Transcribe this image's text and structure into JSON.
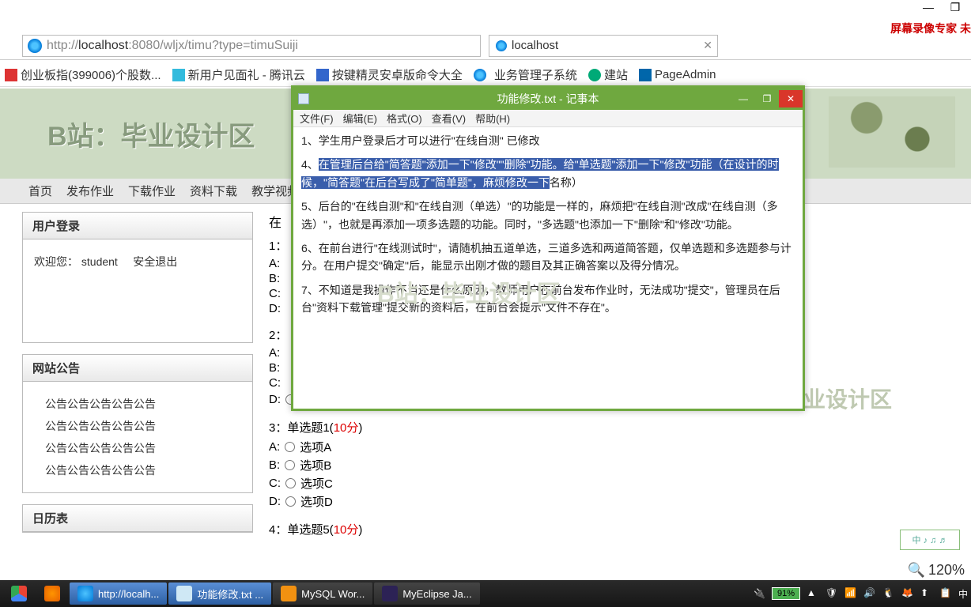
{
  "window": {
    "minimize": "—",
    "maximize": "❐",
    "recorder": "屏幕录像专家 未"
  },
  "addr": {
    "url_gray1": "http://",
    "url_host": "localhost",
    "url_port": ":8080",
    "url_path": "/wljx/timu?type=timuSuiji",
    "tab": "localhost"
  },
  "bookmarks": {
    "b1": "创业板指(399006)个股数...",
    "b2": "新用户见面礼 - 腾讯云",
    "b3": "按键精灵安卓版命令大全",
    "b4": "业务管理子系统",
    "b5": "建站",
    "b6": "PageAdmin"
  },
  "banner": {
    "text": "B站：毕业设计区"
  },
  "nav": {
    "n1": "首页",
    "n2": "发布作业",
    "n3": "下载作业",
    "n4": "资料下载",
    "n5": "教学视频"
  },
  "login": {
    "title": "用户登录",
    "welcome": "欢迎您：",
    "user": "student",
    "logout": "安全退出"
  },
  "notice": {
    "title": "网站公告",
    "item": "公告公告公告公告公告"
  },
  "calendar": {
    "title": "日历表"
  },
  "quiz": {
    "partial_title": "在",
    "q1_prefix": "1：",
    "q2_prefix": "2：",
    "a": "A:",
    "b": "B:",
    "c": "C:",
    "d": "D:",
    "optA": "选项A",
    "optB": "选项B",
    "optC": "选项C",
    "optD": "选项D",
    "q3": "3：单选题1(",
    "q3_score": "10分",
    "q3_suf": ")",
    "q4": "4：单选题5(",
    "q4_score": "10分",
    "q4_suf": ")"
  },
  "watermark": "B站：毕业设计区",
  "zoom": {
    "val": "120%"
  },
  "notepad": {
    "title": "功能修改.txt - 记事本",
    "menu": {
      "file": "文件(F)",
      "edit": "编辑(E)",
      "format": "格式(O)",
      "view": "查看(V)",
      "help": "帮助(H)"
    },
    "l1": "1、学生用户登录后才可以进行\"在线自测\"    已修改",
    "l4a": "4、",
    "hl": "在管理后台给\"简答题\"添加一下\"修改\"\"删除\"功能。给\"单选题\"添加一下\"修改\"功能（在设计的时候，\"简答题\"在后台写成了\"简单题\"，麻烦修改一下",
    "l4b": "名称）",
    "l5": "5、后台的\"在线自测\"和\"在线自测（单选）\"的功能是一样的，麻烦把\"在线自测\"改成\"在线自测（多选）\"，也就是再添加一项多选题的功能。同时，\"多选题\"也添加一下\"删除\"和\"修改\"功能。",
    "l6": "6、在前台进行\"在线测试时\"，请随机抽五道单选，三道多选和两道简答题，仅单选题和多选题参与计分。在用户提交\"确定\"后，能显示出刚才做的题目及其正确答案以及得分情况。",
    "l7": "7、不知道是我操作不当还是什么原因，教师用户在前台发布作业时，无法成功\"提交\"，管理员在后台\"资料下载管理\"提交新的资料后，在前台会提示\"文件不存在\"。",
    "wm": "B站：毕业设计区"
  },
  "taskbar": {
    "t1": "http://localh...",
    "t2": "功能修改.txt ...",
    "t3": "MySQL Wor...",
    "t4": "MyEclipse Ja...",
    "battery": "91%",
    "time": "中"
  },
  "help_badge": "中 ♪ ♫ ♬"
}
